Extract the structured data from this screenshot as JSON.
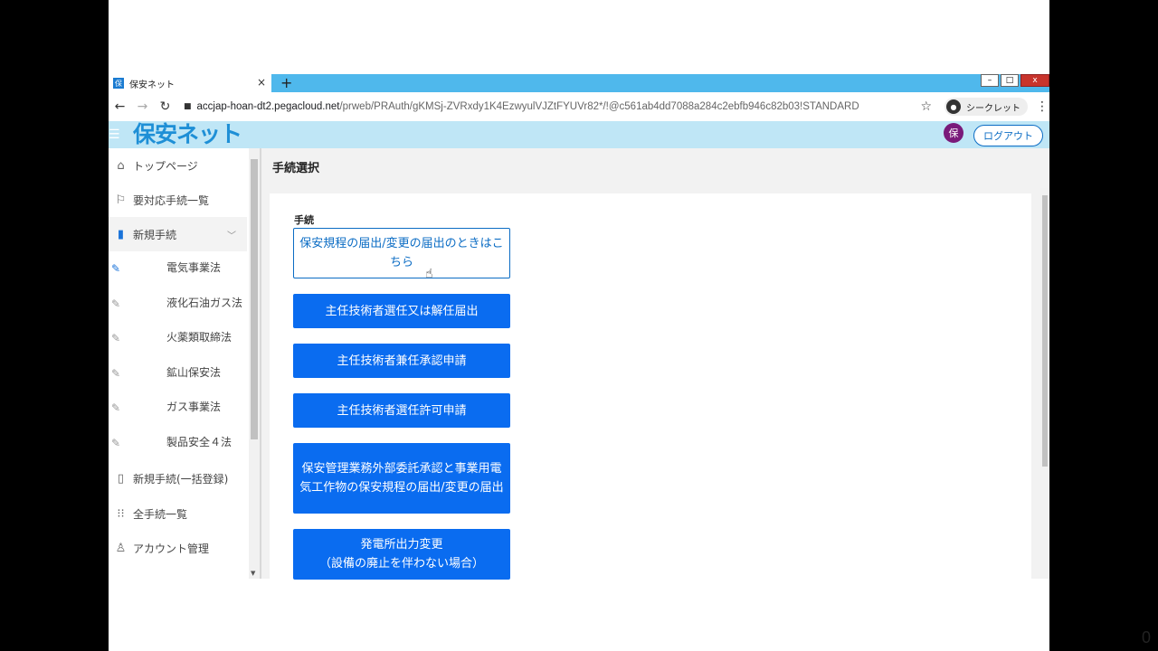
{
  "browser": {
    "tab_title": "保安ネット",
    "tab_favicon": "保",
    "tab_close": "×",
    "new_tab": "+",
    "url_host": "accjap-hoan-dt2.pegacloud.net",
    "url_path": "/prweb/PRAuth/gKMSj-ZVRxdy1K4EzwyulVJZtFYUVr82*/!@c561ab4dd7088a284c2ebfb946c82b03!STANDARD",
    "incognito_label": "シークレット",
    "window_controls": [
      "–",
      "□",
      "x"
    ]
  },
  "header": {
    "logo": "保安ネット",
    "avatar": "保",
    "logout_label": "ログアウト"
  },
  "sidebar": {
    "items": [
      {
        "label": "トップページ",
        "icon": "home-icon"
      },
      {
        "label": "要対応手続一覧",
        "icon": "flag-icon"
      },
      {
        "label": "新規手続",
        "icon": "document-icon"
      },
      {
        "label": "新規手続(一括登録)",
        "icon": "file-icon"
      },
      {
        "label": "全手続一覧",
        "icon": "grid-icon"
      },
      {
        "label": "アカウント管理",
        "icon": "user-icon"
      }
    ],
    "sub_items": [
      {
        "label": "電気事業法",
        "icon": "pencil-icon",
        "active": true
      },
      {
        "label": "液化石油ガス法",
        "icon": "pencil-icon"
      },
      {
        "label": "火薬類取締法",
        "icon": "pencil-icon"
      },
      {
        "label": "鉱山保安法",
        "icon": "pencil-icon"
      },
      {
        "label": "ガス事業法",
        "icon": "pencil-icon"
      },
      {
        "label": "製品安全４法",
        "icon": "pencil-icon"
      }
    ]
  },
  "main": {
    "title": "手続選択",
    "field_label": "手続",
    "buttons": [
      {
        "label": "保安規程の届出/変更の届出のときはこちら",
        "style": "outline"
      },
      {
        "label": "主任技術者選任又は解任届出",
        "style": "solid"
      },
      {
        "label": "主任技術者兼任承認申請",
        "style": "solid"
      },
      {
        "label": "主任技術者選任許可申請",
        "style": "solid"
      },
      {
        "label": "保安管理業務外部委託承認と事業用電気工作物の保安規程の届出/変更の届出",
        "style": "solid"
      },
      {
        "label": "発電所出力変更\n（設備の廃止を伴わない場合）",
        "style": "solid"
      }
    ]
  },
  "slide_number": "0",
  "colors": {
    "tab_strip": "#4fb8ec",
    "app_header": "#bfe6f6",
    "logo": "#1e8fd6",
    "primary_button": "#0a6cf0",
    "outline_button": "#0b6cc4",
    "avatar": "#7a1a7a"
  }
}
